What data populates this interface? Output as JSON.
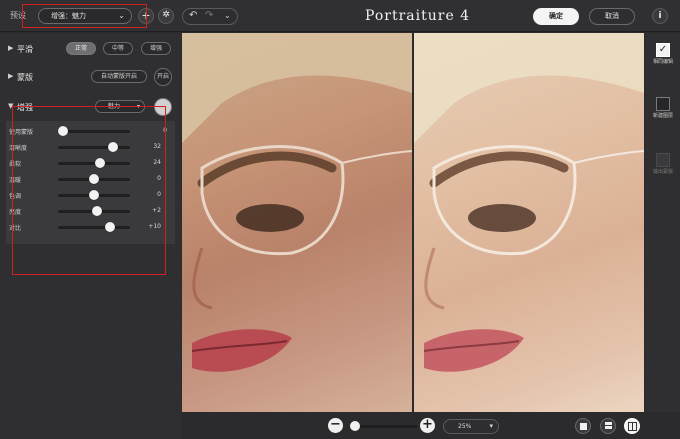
{
  "header": {
    "preset_label": "预设",
    "preset_value": "增强：魅力",
    "app_title": "Portraiture 4",
    "ok_label": "确定",
    "cancel_label": "取消",
    "info_label": "i"
  },
  "sections": [
    {
      "label": "平滑",
      "expanded": false,
      "options": [
        "正常",
        "中等",
        "增强"
      ],
      "selected": 0
    },
    {
      "label": "蒙版",
      "expanded": false,
      "auto_label": "自动蒙版开启",
      "toggle_label": "开启"
    }
  ],
  "enhance": {
    "label": "增强",
    "dropdown_value": "魅力",
    "sliders": [
      {
        "label": "使用蒙版",
        "value": "0"
      },
      {
        "label": "清晰度",
        "value": "32"
      },
      {
        "label": "柔软",
        "value": "24"
      },
      {
        "label": "温暖",
        "value": "0"
      },
      {
        "label": "色调",
        "value": "0"
      },
      {
        "label": "亮度",
        "value": "+2"
      },
      {
        "label": "对比",
        "value": "+10"
      }
    ]
  },
  "rail": [
    {
      "label": "相同编辑",
      "checked": true
    },
    {
      "label": "新建图层",
      "checked": false
    },
    {
      "label": "输出蒙版",
      "checked": false,
      "disabled": true
    }
  ],
  "footer": {
    "zoom_value": "25%",
    "zoom_fraction": 0.0
  },
  "colors": {
    "annotation": "#d02020",
    "background": "#2b2b2d"
  }
}
